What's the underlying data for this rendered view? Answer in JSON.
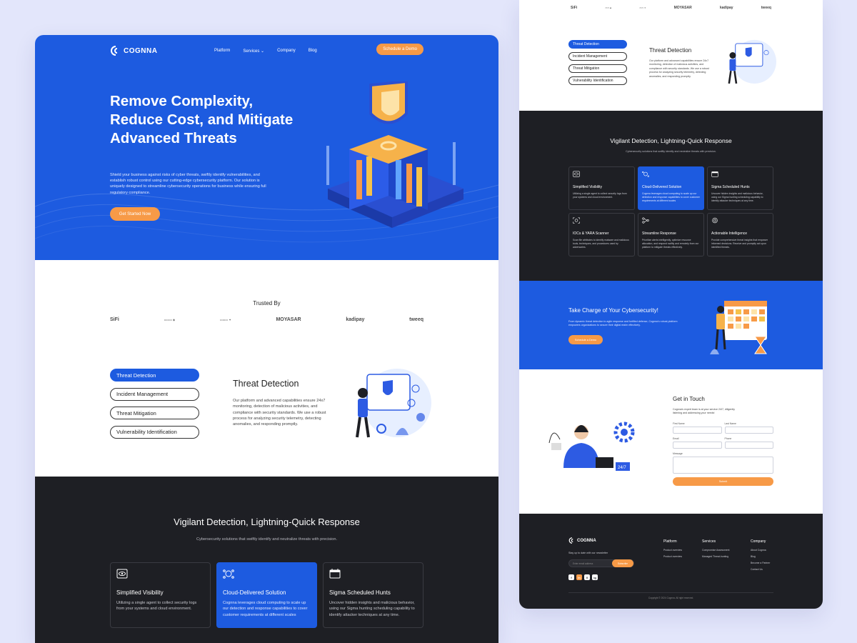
{
  "colors": {
    "primary_blue": "#1d5be0",
    "accent_orange": "#f79a47",
    "dark_bg": "#1e1f24",
    "page_bg": "#e3e6fb"
  },
  "brand": {
    "name": "COGNNA",
    "icon": "cognna-logo-icon"
  },
  "nav": {
    "items": [
      "Platform",
      "Services",
      "Company",
      "Blog"
    ],
    "cta": "Schedule a Demo"
  },
  "hero": {
    "title": "Remove Complexity, Reduce Cost, and Mitigate Advanced Threats",
    "description": "Shield your business against risks of cyber threats, swiftly identify vulnerabilities, and establish robust control using our cutting-edge cybersecurity platform. Our solution is uniquely designed to streamline cybersecurity operations for business while ensuring full regulatory compliance.",
    "button": "Get Started Now"
  },
  "trusted": {
    "title": "Trusted By",
    "logos": [
      "SiFi",
      "",
      "",
      "MOYASAR",
      "kadipay",
      "tweeq"
    ]
  },
  "features_tabs": {
    "tabs": [
      "Threat Detection",
      "Incident Management",
      "Threat Mitigation",
      "Vulnerability Identification"
    ],
    "active_title": "Threat Detection",
    "active_description": "Our platform and advanced capabilities ensure 24x7 monitoring, detection of malicious activities, and compliance with security standards. We use a robust process for analyzing security telemetry, detecting anomalies, and responding promptly."
  },
  "vigilant": {
    "title": "Vigilant Detection, Lightning-Quick Response",
    "subtitle": "Cybersecurity solutions that swiftly identify and neutralize threats with precision.",
    "cards": [
      {
        "icon": "eye-monitor-icon",
        "title": "Simplified Visibility",
        "desc": "Utilizing a single agent to collect security logs from your systems and cloud environment."
      },
      {
        "icon": "cloud-network-icon",
        "title": "Cloud-Delivered Solution",
        "desc": "Cognna leverages cloud computing to scale up our detection and response capabilities to cover customer requirements at different scales"
      },
      {
        "icon": "calendar-icon",
        "title": "Sigma Scheduled Hunts",
        "desc": "Uncover hidden insights and malicious behavior, using our Sigma hunting scheduling capability to identify attacker techniques at any time."
      },
      {
        "icon": "scan-icon",
        "title": "IOCs & YARA Scanner",
        "desc": "Scan file attributes to identify malware and malicious tools, techniques, and procedures used by adversaries."
      },
      {
        "icon": "flow-icon",
        "title": "Streamline Response",
        "desc": "Prioritize alerts intelligently, optimize resource allocation, and respond swiftly and remotely from our platform to mitigate threats effectively."
      },
      {
        "icon": "intel-icon",
        "title": "Actionable Intelligence",
        "desc": "Provide comprehensive threat insights that empower informed decisions. Receive and promptly act upon identified threats."
      }
    ]
  },
  "take_charge": {
    "title": "Take Charge of Your Cybersecurity!",
    "description": "From dynamic threat detection to agile response and fortified defense, Cognna's robust platform empowers organizations to secure their digital realm effectively.",
    "button": "Schedule a Demo"
  },
  "contact": {
    "title": "Get in Touch",
    "description": "Cognna's expert team is at your service 24/7, diligently listening and addressing your needs!",
    "fields": [
      "First Name",
      "Last Name",
      "Email",
      "Phone",
      "Message"
    ],
    "submit": "Submit"
  },
  "footer": {
    "newsletter_label": "Stay up to date with our newsletter",
    "email_placeholder": "Enter email address",
    "subscribe": "Subscribe",
    "social": [
      "f",
      "in",
      "X",
      "ig"
    ],
    "columns": [
      {
        "title": "Platform",
        "links": [
          "Product overview",
          "Product overview"
        ]
      },
      {
        "title": "Services",
        "links": [
          "Compromise Assessment",
          "Managed Threat-hunting"
        ]
      },
      {
        "title": "Company",
        "links": [
          "About Cognna",
          "Blog",
          "Become a Partner",
          "Contact Us"
        ]
      }
    ],
    "copyright": "Copyright © 2024 Cognna. All right reserved."
  }
}
